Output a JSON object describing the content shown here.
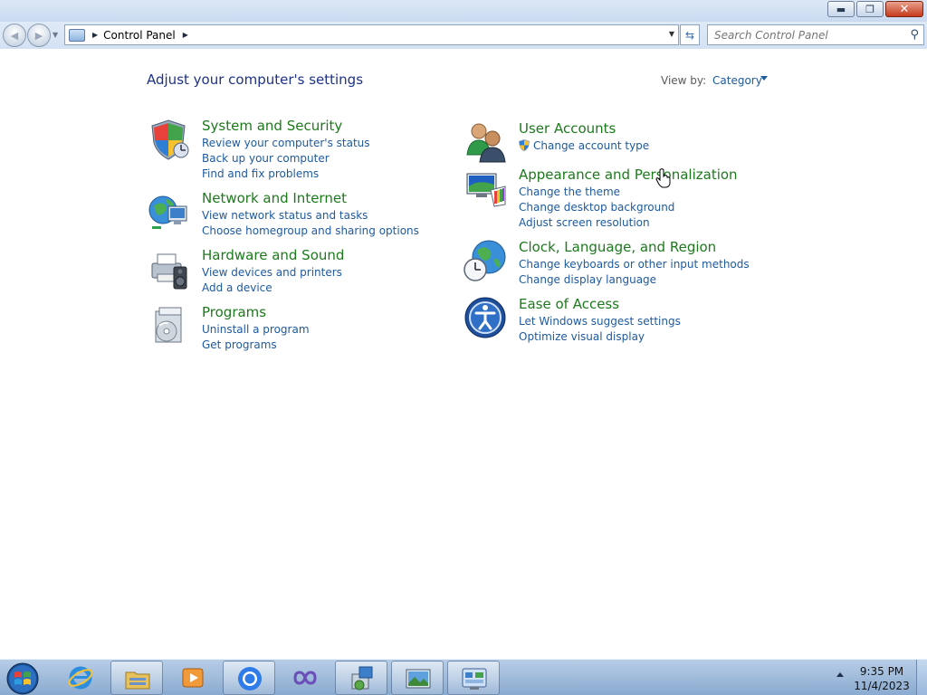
{
  "window": {
    "minimize_glyph": "▬",
    "restore_glyph": "❐",
    "close_glyph": "✕"
  },
  "navigation": {
    "back_glyph": "◀",
    "forward_glyph": "▶",
    "breadcrumb": "Control Panel",
    "search_placeholder": "Search Control Panel"
  },
  "content": {
    "title": "Adjust your computer's settings",
    "view_by_label": "View by:",
    "view_by_value": "Category",
    "categories_left": [
      {
        "name": "System and Security",
        "icon": "shield-icon",
        "links": [
          "Review your computer's status",
          "Back up your computer",
          "Find and fix problems"
        ]
      },
      {
        "name": "Network and Internet",
        "icon": "network-globe-icon",
        "links": [
          "View network status and tasks",
          "Choose homegroup and sharing options"
        ]
      },
      {
        "name": "Hardware and Sound",
        "icon": "printer-speaker-icon",
        "links": [
          "View devices and printers",
          "Add a device"
        ]
      },
      {
        "name": "Programs",
        "icon": "programs-disc-icon",
        "links": [
          "Uninstall a program",
          "Get programs"
        ]
      }
    ],
    "categories_right": [
      {
        "name": "User Accounts",
        "icon": "users-icon",
        "links": [
          "Change account type"
        ]
      },
      {
        "name": "Appearance and Personalization",
        "icon": "monitor-palette-icon",
        "links": [
          "Change the theme",
          "Change desktop background",
          "Adjust screen resolution"
        ]
      },
      {
        "name": "Clock, Language, and Region",
        "icon": "clock-globe-icon",
        "links": [
          "Change keyboards or other input methods",
          "Change display language"
        ]
      },
      {
        "name": "Ease of Access",
        "icon": "ease-of-access-icon",
        "links": [
          "Let Windows suggest settings",
          "Optimize visual display"
        ]
      }
    ]
  },
  "taskbar": {
    "items": [
      {
        "name": "internet-explorer",
        "active": false
      },
      {
        "name": "file-explorer",
        "active": true
      },
      {
        "name": "media-player",
        "active": false
      },
      {
        "name": "chrome",
        "active": true
      },
      {
        "name": "visual-studio",
        "active": false
      },
      {
        "name": "installer-program",
        "active": true
      },
      {
        "name": "image-viewer",
        "active": true
      },
      {
        "name": "control-panel",
        "active": true
      }
    ],
    "time": "9:35 PM",
    "date": "11/4/2023"
  },
  "colors": {
    "category_heading": "#1c7a1c",
    "link": "#1e5aa0",
    "page_title": "#1e3287"
  }
}
